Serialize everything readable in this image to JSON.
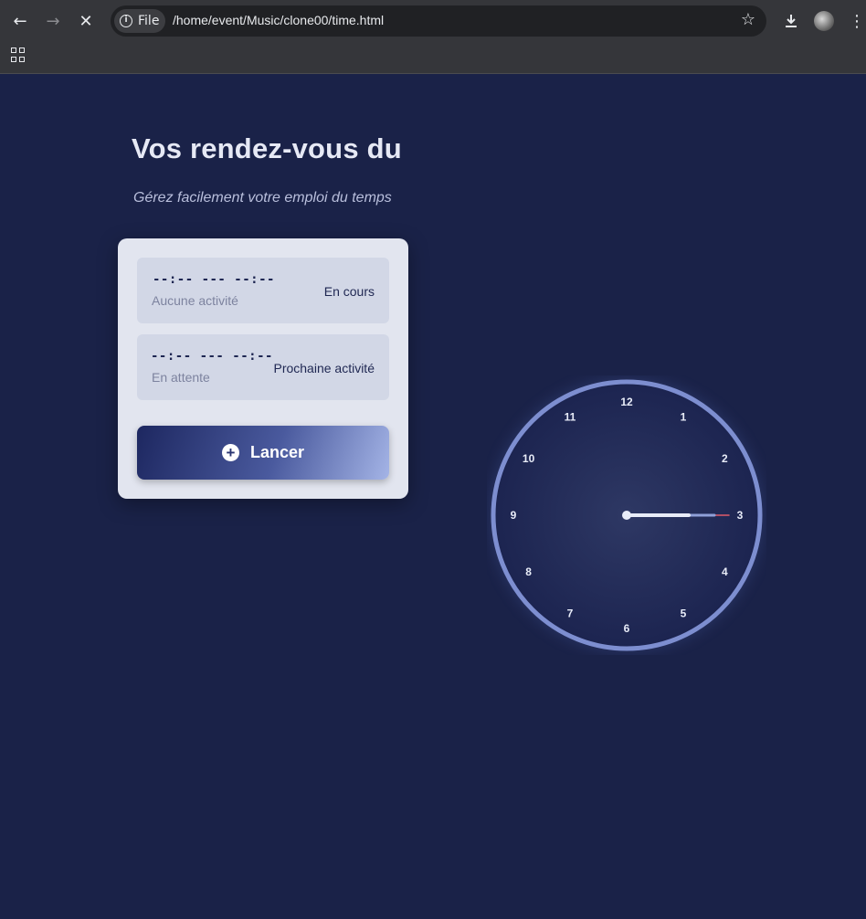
{
  "browser": {
    "site_chip_label": "File",
    "url": "/home/event/Music/clone00/time.html"
  },
  "page": {
    "title": "Vos rendez-vous du",
    "subtitle": "Gérez facilement votre emploi du temps"
  },
  "current": {
    "time": "--:-- --- --:--",
    "status": "Aucune activité",
    "tag": "En cours"
  },
  "next": {
    "time": "--:-- --- --:--",
    "status": "En attente",
    "tag": "Prochaine activité"
  },
  "launch_button": {
    "label": "Lancer"
  },
  "clock": {
    "numbers": [
      "12",
      "1",
      "2",
      "3",
      "4",
      "5",
      "6",
      "7",
      "8",
      "9",
      "10",
      "11"
    ],
    "hour_hand_angle_deg": 90,
    "minute_hand_angle_deg": 90,
    "second_hand_angle_deg": 90,
    "colors": {
      "rim": "#7d8ed0",
      "face": "#2b3460",
      "hand": "#e8ecf8",
      "second": "#e05a6a"
    }
  }
}
